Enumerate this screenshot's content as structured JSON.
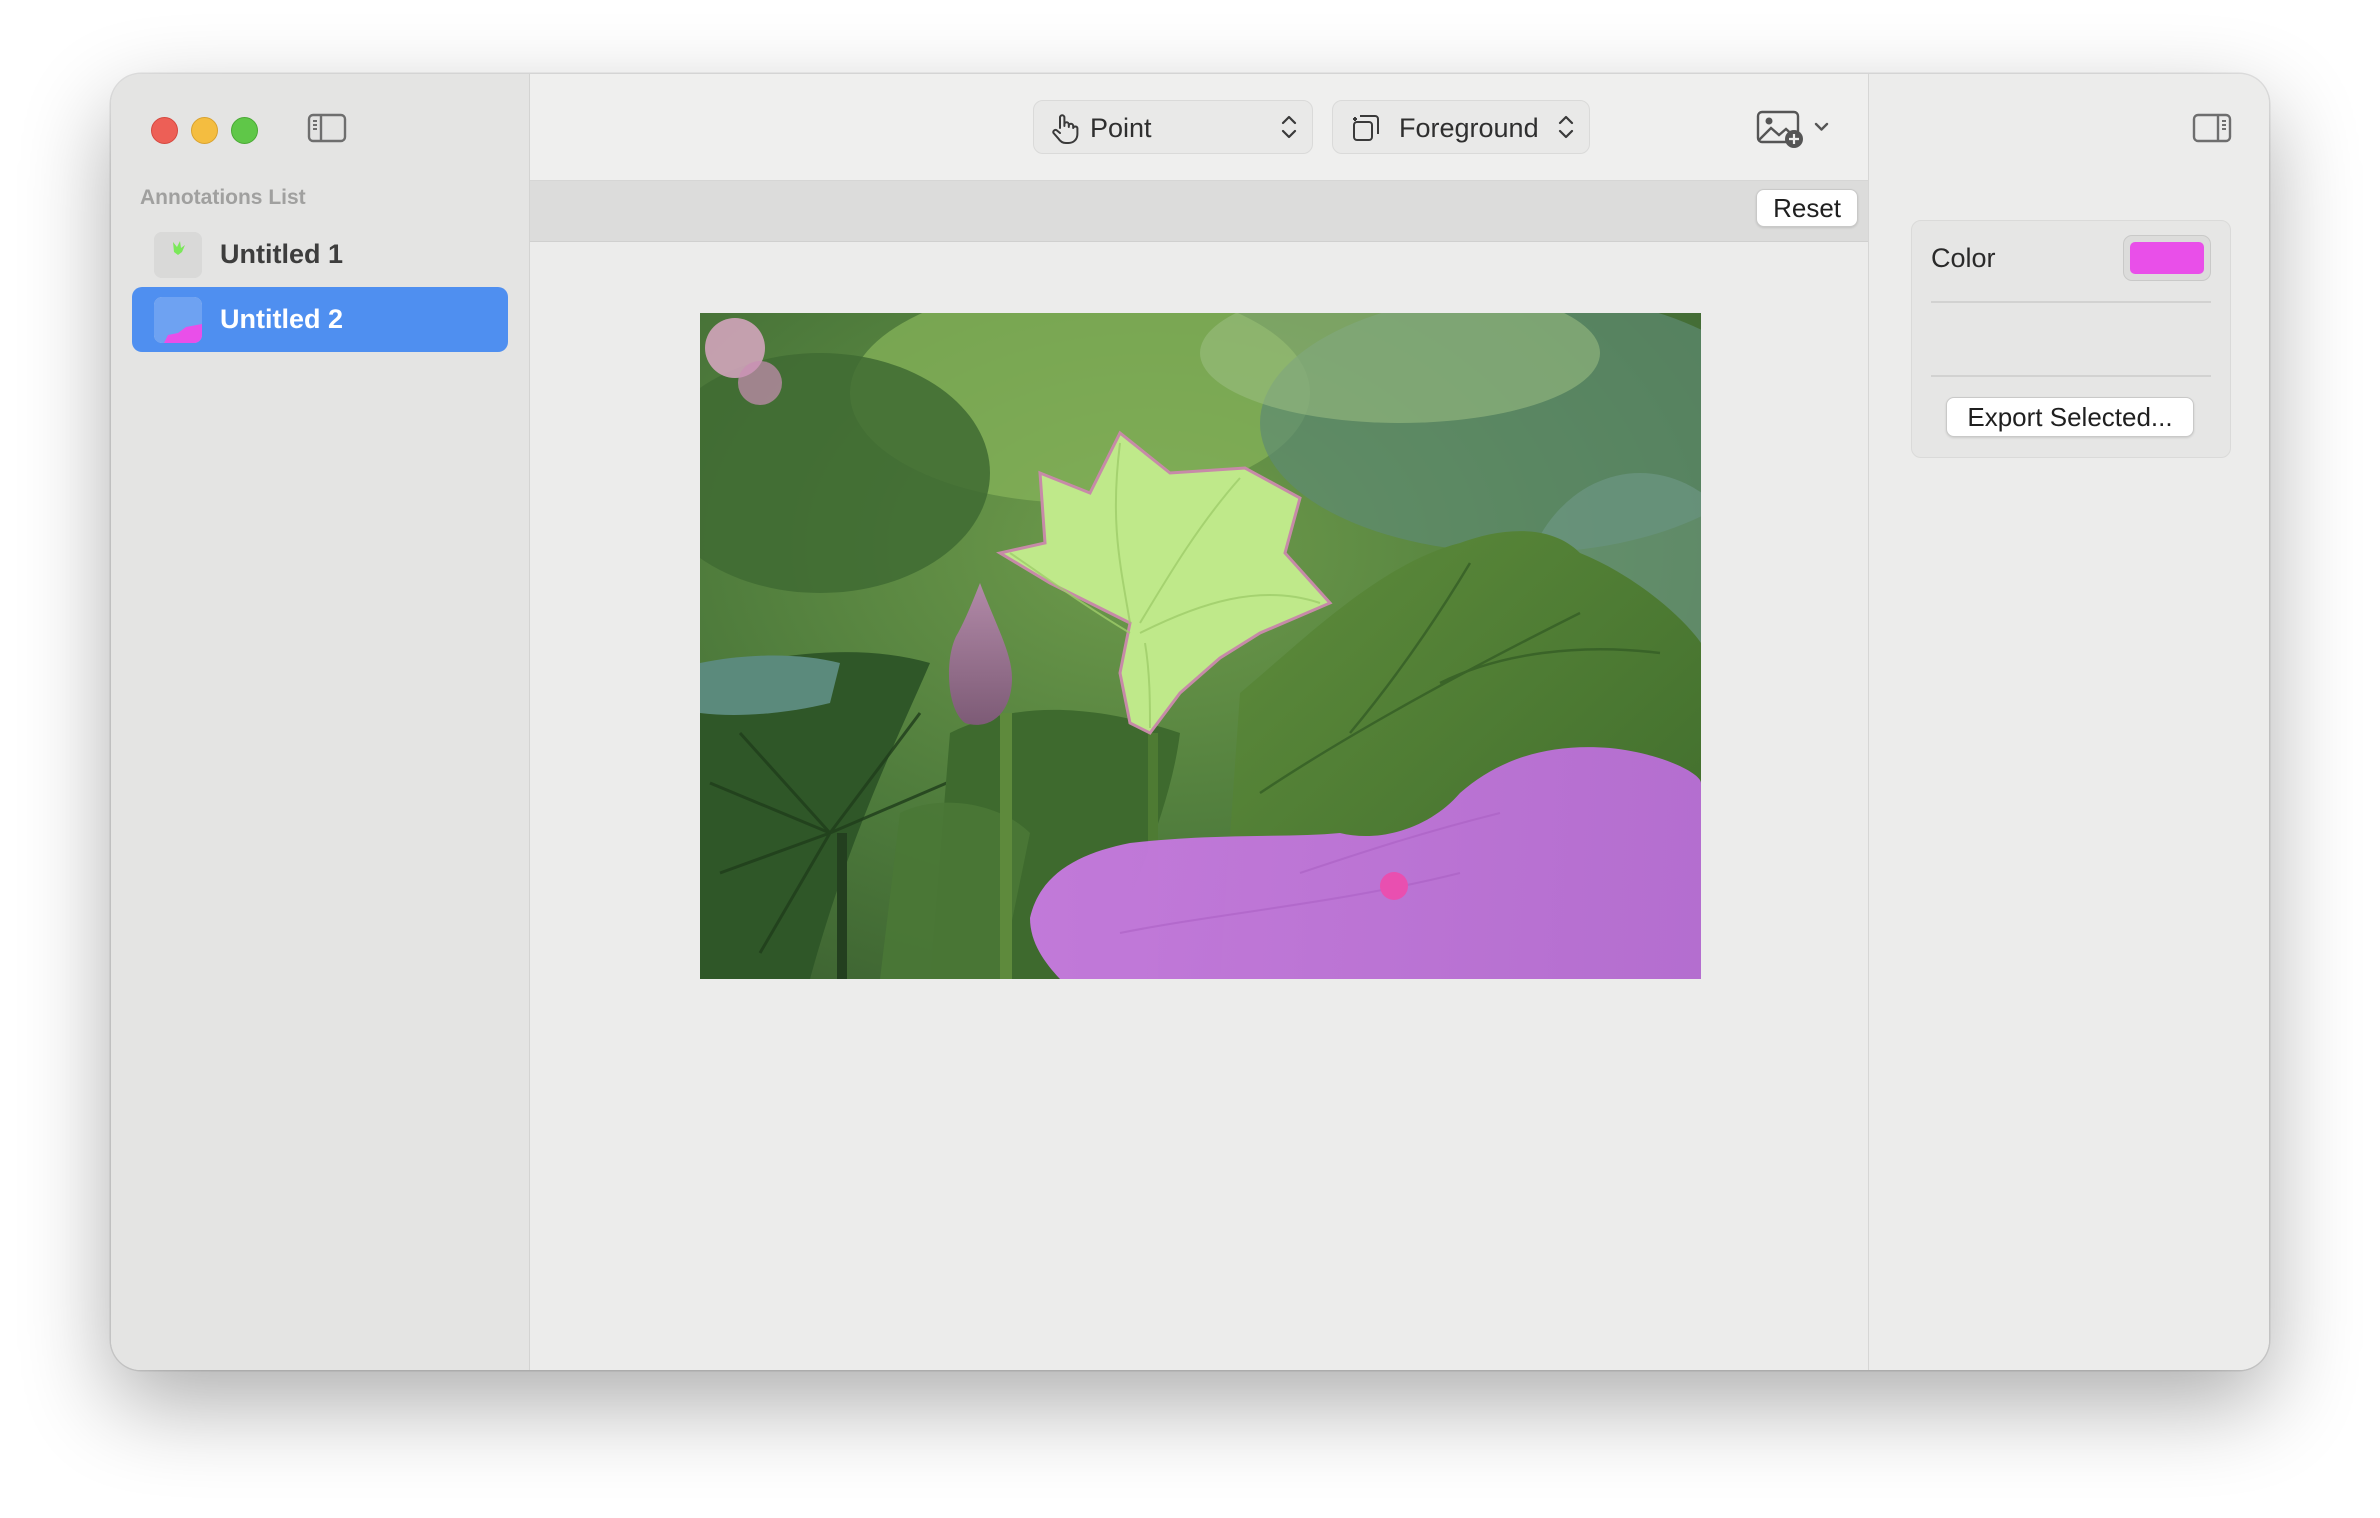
{
  "sidebar": {
    "section_title": "Annotations List",
    "items": [
      {
        "label": "Untitled 1",
        "selected": false,
        "thumb_color": "#7be85a"
      },
      {
        "label": "Untitled 2",
        "selected": true,
        "thumb_color": "#e94fe9"
      }
    ]
  },
  "toolbar": {
    "mode": {
      "selected": "Point",
      "icon": "hand-pointer-icon"
    },
    "layer": {
      "selected": "Foreground",
      "icon": "layers-icon"
    },
    "add_image_icon": "add-photo-icon"
  },
  "canvas": {
    "reset_label": "Reset",
    "image_icon": "lotus-photo"
  },
  "inspector": {
    "color_label": "Color",
    "color_value": "#e94fe9",
    "export_label": "Export Selected..."
  },
  "colors": {
    "accent": "#4f8ff0",
    "mask_foreground": "#c87ee0",
    "mask_point": "#e94fb0"
  }
}
